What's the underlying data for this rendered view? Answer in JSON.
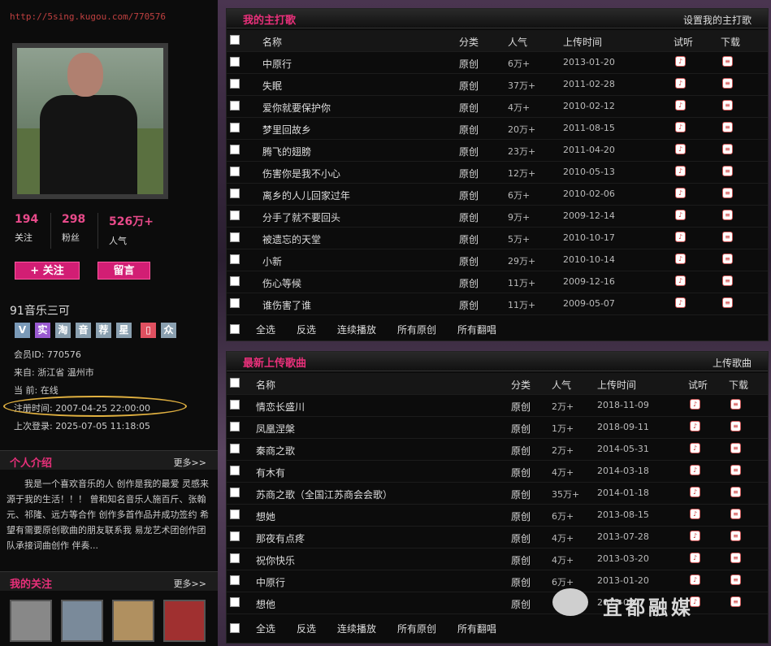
{
  "url": "http://5sing.kugou.com/770576",
  "stats": [
    {
      "num": "194",
      "label": "关注"
    },
    {
      "num": "298",
      "label": "粉丝"
    },
    {
      "num": "526万+",
      "label": "人气"
    }
  ],
  "buttons": {
    "follow": "+ 关注",
    "message": "留言"
  },
  "username": "91音乐三可",
  "badges": [
    "V",
    "实",
    "淘",
    "音",
    "荐",
    "星",
    "▯",
    "众"
  ],
  "info": {
    "member_id": "会员ID:  770576",
    "from": "来自: 浙江省 温州市",
    "current": "当      前: 在线",
    "register": "注册时间: 2007-04-25 22:00:00",
    "last_login": "上次登录: 2025-07-05 11:18:05"
  },
  "intro": {
    "title": "个人介绍",
    "more": "更多>>",
    "text": "我是一个喜欢音乐的人 创作是我的最爱 灵感来源于我的生活！！！ 曾和知名音乐人施百斤、张翰元、祁隆、远方等合作 创作多首作品并成功签约 希望有需要原创歌曲的朋友联系我 易龙艺术团创作团队承接词曲创作 伴奏..."
  },
  "follows": {
    "title": "我的关注",
    "more": "更多>>"
  },
  "colors": {
    "accent": "#e8307a",
    "button": "#d21e74",
    "highlight": "#e0b040"
  },
  "main": {
    "title": "我的主打歌",
    "action": "设置我的主打歌",
    "headers": [
      "名称",
      "分类",
      "人气",
      "上传时间",
      "试听",
      "下载"
    ],
    "songs": [
      {
        "name": "中原行",
        "cat": "原创",
        "pop": "6万+",
        "date": "2013-01-20"
      },
      {
        "name": "失眠",
        "cat": "原创",
        "pop": "37万+",
        "date": "2011-02-28"
      },
      {
        "name": "爱你就要保护你",
        "cat": "原创",
        "pop": "4万+",
        "date": "2010-02-12"
      },
      {
        "name": "梦里回故乡",
        "cat": "原创",
        "pop": "20万+",
        "date": "2011-08-15"
      },
      {
        "name": "腾飞的翅膀",
        "cat": "原创",
        "pop": "23万+",
        "date": "2011-04-20"
      },
      {
        "name": "伤害你是我不小心",
        "cat": "原创",
        "pop": "12万+",
        "date": "2010-05-13"
      },
      {
        "name": "离乡的人儿回家过年",
        "cat": "原创",
        "pop": "6万+",
        "date": "2010-02-06"
      },
      {
        "name": "分手了就不要回头",
        "cat": "原创",
        "pop": "9万+",
        "date": "2009-12-14"
      },
      {
        "name": "被遗忘的天堂",
        "cat": "原创",
        "pop": "5万+",
        "date": "2010-10-17"
      },
      {
        "name": "小新",
        "cat": "原创",
        "pop": "29万+",
        "date": "2010-10-14"
      },
      {
        "name": "伤心等候",
        "cat": "原创",
        "pop": "11万+",
        "date": "2009-12-16"
      },
      {
        "name": "谁伤害了谁",
        "cat": "原创",
        "pop": "11万+",
        "date": "2009-05-07"
      }
    ],
    "footer": [
      "全选",
      "反选",
      "连续播放",
      "所有原创",
      "所有翻唱"
    ]
  },
  "latest": {
    "title": "最新上传歌曲",
    "action": "上传歌曲",
    "headers": [
      "名称",
      "分类",
      "人气",
      "上传时间",
      "试听",
      "下载"
    ],
    "songs": [
      {
        "name": "情恋长盛川",
        "cat": "原创",
        "pop": "2万+",
        "date": "2018-11-09"
      },
      {
        "name": "凤凰涅槃",
        "cat": "原创",
        "pop": "1万+",
        "date": "2018-09-11"
      },
      {
        "name": "秦商之歌",
        "cat": "原创",
        "pop": "2万+",
        "date": "2014-05-31"
      },
      {
        "name": "有木有",
        "cat": "原创",
        "pop": "4万+",
        "date": "2014-03-18"
      },
      {
        "name": "苏商之歌（全国江苏商会会歌）",
        "cat": "原创",
        "pop": "35万+",
        "date": "2014-01-18"
      },
      {
        "name": "想她",
        "cat": "原创",
        "pop": "6万+",
        "date": "2013-08-15"
      },
      {
        "name": "那夜有点疼",
        "cat": "原创",
        "pop": "4万+",
        "date": "2013-07-28"
      },
      {
        "name": "祝你快乐",
        "cat": "原创",
        "pop": "4万+",
        "date": "2013-03-20"
      },
      {
        "name": "中原行",
        "cat": "原创",
        "pop": "6万+",
        "date": "2013-01-20"
      },
      {
        "name": "想他",
        "cat": "原创",
        "pop": "",
        "date": "2013-08-"
      }
    ],
    "footer": [
      "全选",
      "反选",
      "连续播放",
      "所有原创",
      "所有翻唱"
    ]
  },
  "watermark": "宜都融媒"
}
